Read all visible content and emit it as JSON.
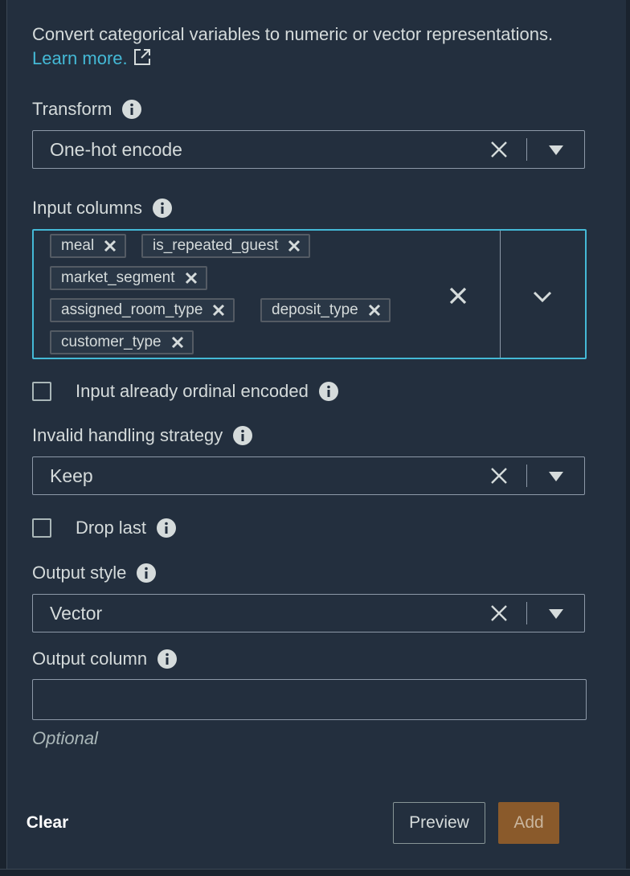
{
  "description": {
    "text": "Convert categorical variables to numeric or vector representations. ",
    "link": "Learn more."
  },
  "transform": {
    "label": "Transform",
    "value": "One-hot encode"
  },
  "input_columns": {
    "label": "Input columns",
    "tags": [
      "meal",
      "is_repeated_guest",
      "market_segment",
      "assigned_room_type",
      "deposit_type",
      "customer_type"
    ]
  },
  "ordinal_checkbox": {
    "label": "Input already ordinal encoded",
    "checked": false
  },
  "invalid_handling": {
    "label": "Invalid handling strategy",
    "value": "Keep"
  },
  "drop_last_checkbox": {
    "label": "Drop last",
    "checked": false
  },
  "output_style": {
    "label": "Output style",
    "value": "Vector"
  },
  "output_column": {
    "label": "Output column",
    "value": "",
    "hint": "Optional"
  },
  "footer": {
    "clear_label": "Clear",
    "preview_label": "Preview",
    "add_label": "Add"
  },
  "colors": {
    "background": "#232f3e",
    "link": "#44b9d6",
    "focus_border": "#44b9d6",
    "primary_button": "#8a5a2b"
  }
}
